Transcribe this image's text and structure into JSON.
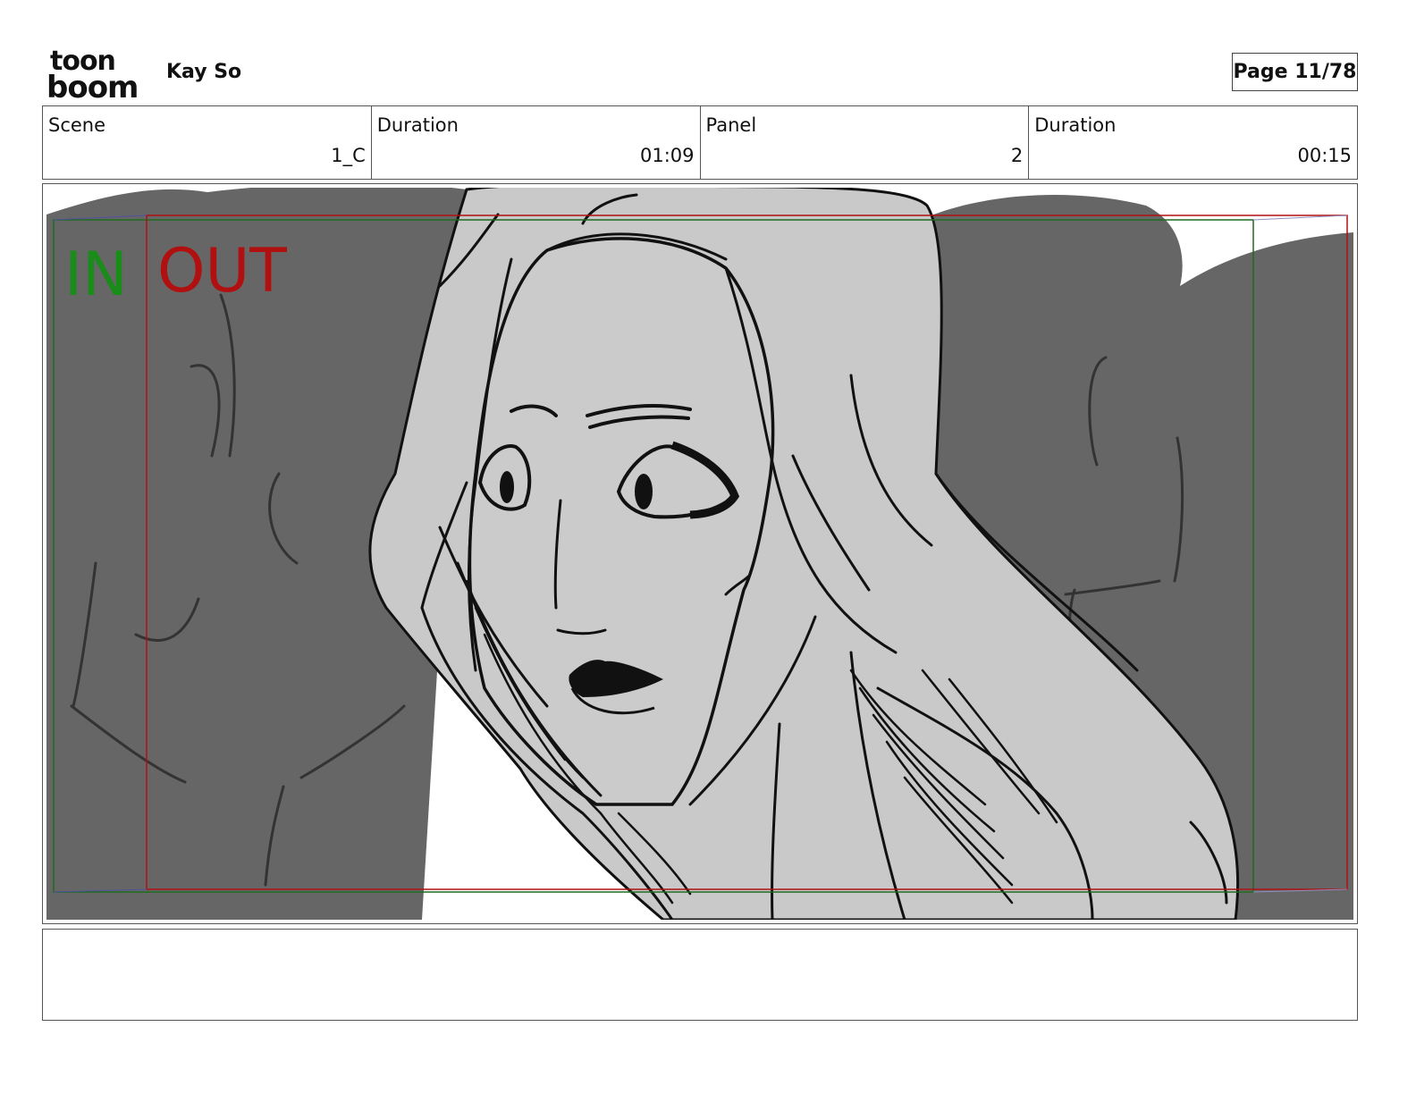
{
  "header": {
    "brand_top": "toon",
    "brand_bottom": "boom",
    "author": "Kay So",
    "page": "Page 11/78"
  },
  "info": {
    "scene_label": "Scene",
    "scene_value": "1_C",
    "scene_duration_label": "Duration",
    "scene_duration_value": "01:09",
    "panel_label": "Panel",
    "panel_value": "2",
    "panel_duration_label": "Duration",
    "panel_duration_value": "00:15"
  },
  "frame": {
    "in_label": "IN",
    "out_label": "OUT",
    "in_color": "#1a8c1a",
    "out_color": "#b01010"
  },
  "notes": {
    "text": ""
  }
}
